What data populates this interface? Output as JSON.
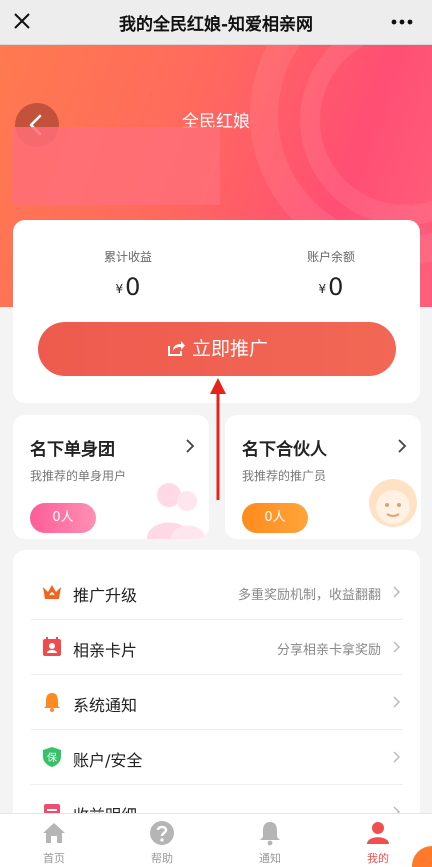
{
  "window": {
    "title": "我的全民红娘-知爱相亲网"
  },
  "header": {
    "title": "全民红娘"
  },
  "earnings": {
    "total_label": "累计收益",
    "total_currency": "¥",
    "total_value": "0",
    "balance_label": "账户余额",
    "balance_currency": "¥",
    "balance_value": "0",
    "promote_label": "立即推广"
  },
  "teams": [
    {
      "title": "名下单身团",
      "subtitle": "我推荐的单身用户",
      "count": "0人",
      "color": "#ff6aa0"
    },
    {
      "title": "名下合伙人",
      "subtitle": "我推荐的推广员",
      "count": "0人",
      "color": "#ff9326"
    }
  ],
  "menu": [
    {
      "label": "推广升级",
      "hint": "多重奖励机制，收益翻翻",
      "icon": "crown-icon"
    },
    {
      "label": "相亲卡片",
      "hint": "分享相亲卡拿奖励",
      "icon": "card-icon"
    },
    {
      "label": "系统通知",
      "hint": "",
      "icon": "bell-icon"
    },
    {
      "label": "账户/安全",
      "hint": "",
      "icon": "shield-icon",
      "badge_text": "保"
    },
    {
      "label": "收益明细",
      "hint": "",
      "icon": "list-icon"
    }
  ],
  "tabbar": [
    {
      "label": "首页",
      "icon": "home-icon"
    },
    {
      "label": "帮助",
      "icon": "help-icon"
    },
    {
      "label": "通知",
      "icon": "bell-icon"
    },
    {
      "label": "我的",
      "icon": "user-icon",
      "active": true
    }
  ],
  "colors": {
    "accent": "#f04f4f",
    "header_start": "#ff7a4f",
    "header_end": "#ff4f74",
    "annotation": "#e3241b"
  }
}
